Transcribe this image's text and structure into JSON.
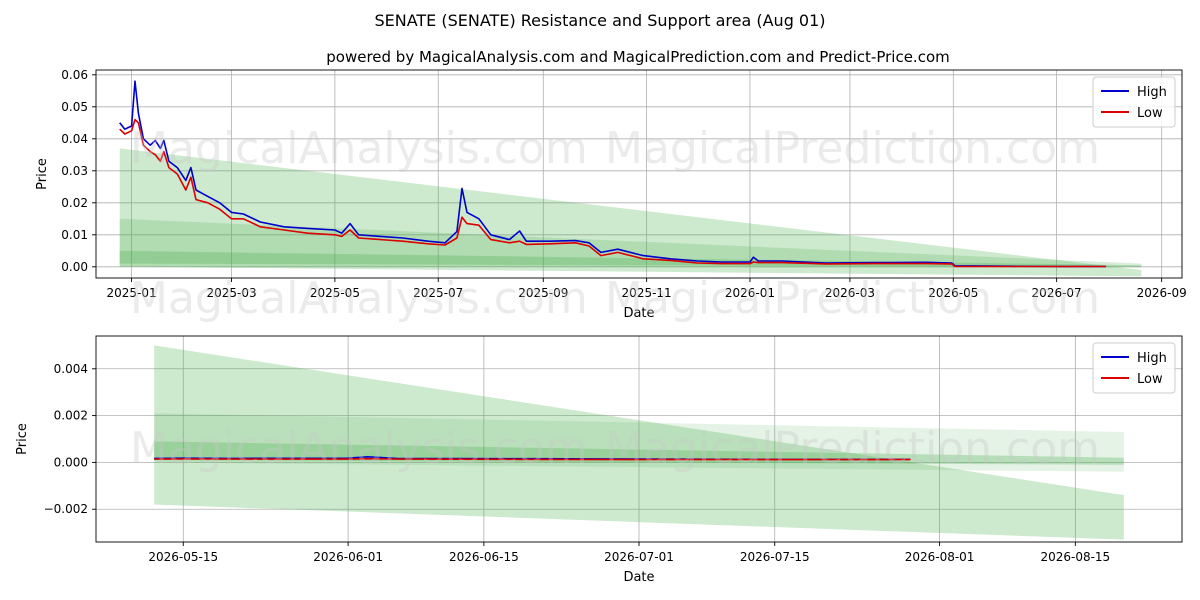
{
  "figure": {
    "title": "SENATE (SENATE) Resistance and Support area (Aug 01)",
    "subtitle": "powered by MagicalAnalysis.com and MagicalPrediction.com and Predict-Price.com",
    "watermarks": [
      "MagicalAnalysis.com",
      "MagicalPrediction.com"
    ]
  },
  "colors": {
    "high": "#0000cc",
    "low": "#dd0000",
    "band": "#4caf50",
    "grid": "#b0b0b0"
  },
  "chart_data": [
    {
      "type": "line",
      "name": "overview",
      "xlabel": "Date",
      "ylabel": "Price",
      "ylim": [
        -0.0035,
        0.0615
      ],
      "xlim": [
        "2024-12-11",
        "2026-09-13"
      ],
      "xticks": [
        "2025-01",
        "2025-03",
        "2025-05",
        "2025-07",
        "2025-09",
        "2025-11",
        "2026-01",
        "2026-03",
        "2026-05",
        "2026-07",
        "2026-09"
      ],
      "xtick_dates": [
        "2025-01-01",
        "2025-03-01",
        "2025-05-01",
        "2025-07-01",
        "2025-09-01",
        "2025-11-01",
        "2026-01-01",
        "2026-03-01",
        "2026-05-01",
        "2026-07-01",
        "2026-09-01"
      ],
      "yticks": [
        "0.00",
        "0.01",
        "0.02",
        "0.03",
        "0.04",
        "0.05",
        "0.06"
      ],
      "ytick_values": [
        0,
        0.01,
        0.02,
        0.03,
        0.04,
        0.05,
        0.06
      ],
      "grid": true,
      "legend": "top-right",
      "legend_entries": [
        "High",
        "Low"
      ],
      "series": [
        {
          "name": "High",
          "color": "#0000cc",
          "points": [
            [
              "2024-12-25",
              0.045
            ],
            [
              "2024-12-28",
              0.043
            ],
            [
              "2025-01-01",
              0.044
            ],
            [
              "2025-01-03",
              0.058
            ],
            [
              "2025-01-05",
              0.048
            ],
            [
              "2025-01-08",
              0.04
            ],
            [
              "2025-01-12",
              0.038
            ],
            [
              "2025-01-15",
              0.0395
            ],
            [
              "2025-01-18",
              0.037
            ],
            [
              "2025-01-20",
              0.0395
            ],
            [
              "2025-01-23",
              0.033
            ],
            [
              "2025-01-28",
              0.031
            ],
            [
              "2025-02-02",
              0.027
            ],
            [
              "2025-02-05",
              0.031
            ],
            [
              "2025-02-08",
              0.024
            ],
            [
              "2025-02-15",
              0.022
            ],
            [
              "2025-02-22",
              0.02
            ],
            [
              "2025-03-01",
              0.017
            ],
            [
              "2025-03-08",
              0.0165
            ],
            [
              "2025-03-18",
              0.014
            ],
            [
              "2025-04-01",
              0.0125
            ],
            [
              "2025-04-15",
              0.012
            ],
            [
              "2025-05-01",
              0.0115
            ],
            [
              "2025-05-05",
              0.0105
            ],
            [
              "2025-05-10",
              0.0135
            ],
            [
              "2025-05-15",
              0.01
            ],
            [
              "2025-05-28",
              0.0095
            ],
            [
              "2025-06-10",
              0.009
            ],
            [
              "2025-06-25",
              0.008
            ],
            [
              "2025-07-05",
              0.0075
            ],
            [
              "2025-07-12",
              0.011
            ],
            [
              "2025-07-15",
              0.0245
            ],
            [
              "2025-07-18",
              0.017
            ],
            [
              "2025-07-25",
              0.015
            ],
            [
              "2025-08-01",
              0.01
            ],
            [
              "2025-08-12",
              0.0085
            ],
            [
              "2025-08-18",
              0.0112
            ],
            [
              "2025-08-22",
              0.008
            ],
            [
              "2025-09-05",
              0.008
            ],
            [
              "2025-09-20",
              0.0082
            ],
            [
              "2025-09-28",
              0.0075
            ],
            [
              "2025-10-05",
              0.0045
            ],
            [
              "2025-10-15",
              0.0055
            ],
            [
              "2025-10-30",
              0.0035
            ],
            [
              "2025-11-15",
              0.0025
            ],
            [
              "2025-12-01",
              0.0018
            ],
            [
              "2025-12-15",
              0.0015
            ],
            [
              "2026-01-01",
              0.0015
            ],
            [
              "2026-01-03",
              0.003
            ],
            [
              "2026-01-06",
              0.0018
            ],
            [
              "2026-01-20",
              0.0018
            ],
            [
              "2026-02-15",
              0.0012
            ],
            [
              "2026-03-15",
              0.0013
            ],
            [
              "2026-04-15",
              0.0014
            ],
            [
              "2026-04-30",
              0.0012
            ],
            [
              "2026-05-02",
              0.0003
            ],
            [
              "2026-06-01",
              0.0002
            ],
            [
              "2026-07-01",
              0.0001
            ],
            [
              "2026-07-30",
              0.0001
            ]
          ]
        },
        {
          "name": "Low",
          "color": "#dd0000",
          "points": [
            [
              "2024-12-25",
              0.043
            ],
            [
              "2024-12-28",
              0.0415
            ],
            [
              "2025-01-01",
              0.0425
            ],
            [
              "2025-01-03",
              0.046
            ],
            [
              "2025-01-05",
              0.045
            ],
            [
              "2025-01-08",
              0.038
            ],
            [
              "2025-01-12",
              0.036
            ],
            [
              "2025-01-15",
              0.035
            ],
            [
              "2025-01-18",
              0.033
            ],
            [
              "2025-01-20",
              0.036
            ],
            [
              "2025-01-23",
              0.031
            ],
            [
              "2025-01-28",
              0.029
            ],
            [
              "2025-02-02",
              0.024
            ],
            [
              "2025-02-05",
              0.028
            ],
            [
              "2025-02-08",
              0.021
            ],
            [
              "2025-02-15",
              0.02
            ],
            [
              "2025-02-22",
              0.018
            ],
            [
              "2025-03-01",
              0.015
            ],
            [
              "2025-03-08",
              0.015
            ],
            [
              "2025-03-18",
              0.0125
            ],
            [
              "2025-04-01",
              0.0115
            ],
            [
              "2025-04-15",
              0.0105
            ],
            [
              "2025-05-01",
              0.01
            ],
            [
              "2025-05-05",
              0.0095
            ],
            [
              "2025-05-10",
              0.0115
            ],
            [
              "2025-05-15",
              0.009
            ],
            [
              "2025-05-28",
              0.0085
            ],
            [
              "2025-06-10",
              0.008
            ],
            [
              "2025-06-25",
              0.0072
            ],
            [
              "2025-07-05",
              0.0068
            ],
            [
              "2025-07-12",
              0.009
            ],
            [
              "2025-07-15",
              0.0155
            ],
            [
              "2025-07-18",
              0.0135
            ],
            [
              "2025-07-25",
              0.013
            ],
            [
              "2025-08-01",
              0.0085
            ],
            [
              "2025-08-12",
              0.0075
            ],
            [
              "2025-08-18",
              0.008
            ],
            [
              "2025-08-22",
              0.007
            ],
            [
              "2025-09-05",
              0.0072
            ],
            [
              "2025-09-20",
              0.0075
            ],
            [
              "2025-09-28",
              0.0065
            ],
            [
              "2025-10-05",
              0.0035
            ],
            [
              "2025-10-15",
              0.0045
            ],
            [
              "2025-10-30",
              0.0025
            ],
            [
              "2025-11-15",
              0.002
            ],
            [
              "2025-12-01",
              0.0012
            ],
            [
              "2025-12-15",
              0.001
            ],
            [
              "2026-01-01",
              0.001
            ],
            [
              "2026-01-03",
              0.0015
            ],
            [
              "2026-01-06",
              0.0013
            ],
            [
              "2026-01-20",
              0.0013
            ],
            [
              "2026-02-15",
              0.0009
            ],
            [
              "2026-03-15",
              0.001
            ],
            [
              "2026-04-15",
              0.001
            ],
            [
              "2026-04-30",
              0.0009
            ],
            [
              "2026-05-02",
              0.0001
            ],
            [
              "2026-06-01",
              0.0001
            ],
            [
              "2026-07-01",
              0.0001
            ],
            [
              "2026-07-30",
              0.0001
            ]
          ]
        }
      ],
      "bands": [
        {
          "x": [
            "2024-12-25",
            "2026-08-20"
          ],
          "upper": [
            0.037,
            -0.001
          ],
          "lower": [
            0.0,
            -0.003
          ],
          "opacity": 0.28
        },
        {
          "x": [
            "2024-12-25",
            "2026-08-20"
          ],
          "upper": [
            0.015,
            0.001
          ],
          "lower": [
            0.0,
            -0.0002
          ],
          "opacity": 0.22
        },
        {
          "x": [
            "2024-12-25",
            "2026-08-20"
          ],
          "upper": [
            0.005,
            0.0005
          ],
          "lower": [
            0.001,
            0.0
          ],
          "opacity": 0.3
        }
      ]
    },
    {
      "type": "line",
      "name": "detail",
      "xlabel": "Date",
      "ylabel": "Price",
      "ylim": [
        -0.0034,
        0.0054
      ],
      "xlim": [
        "2026-05-06",
        "2026-08-26"
      ],
      "xticks": [
        "2026-05-15",
        "2026-06-01",
        "2026-06-15",
        "2026-07-01",
        "2026-07-15",
        "2026-08-01",
        "2026-08-15"
      ],
      "xtick_dates": [
        "2026-05-15",
        "2026-06-01",
        "2026-06-15",
        "2026-07-01",
        "2026-07-15",
        "2026-08-01",
        "2026-08-15"
      ],
      "yticks": [
        "−0.002",
        "0.000",
        "0.002",
        "0.004"
      ],
      "ytick_values": [
        -0.002,
        0,
        0.002,
        0.004
      ],
      "grid": true,
      "legend": "top-right",
      "legend_entries": [
        "High",
        "Low"
      ],
      "series": [
        {
          "name": "High",
          "color": "#0000cc",
          "points": [
            [
              "2026-05-12",
              0.00017
            ],
            [
              "2026-05-15",
              0.00018
            ],
            [
              "2026-05-20",
              0.00017
            ],
            [
              "2026-06-01",
              0.00018
            ],
            [
              "2026-06-03",
              0.00024
            ],
            [
              "2026-06-06",
              0.00017
            ],
            [
              "2026-06-20",
              0.00016
            ],
            [
              "2026-07-01",
              0.00014
            ],
            [
              "2026-07-15",
              0.00013
            ],
            [
              "2026-07-29",
              0.00013
            ]
          ]
        },
        {
          "name": "Low",
          "color": "#dd0000",
          "points": [
            [
              "2026-05-12",
              0.00014
            ],
            [
              "2026-05-15",
              0.00015
            ],
            [
              "2026-05-20",
              0.00014
            ],
            [
              "2026-06-01",
              0.00014
            ],
            [
              "2026-06-03",
              0.00016
            ],
            [
              "2026-06-06",
              0.00014
            ],
            [
              "2026-06-20",
              0.00013
            ],
            [
              "2026-07-01",
              0.00012
            ],
            [
              "2026-07-15",
              0.00012
            ],
            [
              "2026-07-29",
              0.00012
            ]
          ]
        }
      ],
      "bands": [
        {
          "x": [
            "2026-05-12",
            "2026-08-20"
          ],
          "upper": [
            0.005,
            -0.0014
          ],
          "lower": [
            -0.0018,
            -0.0033
          ],
          "opacity": 0.28
        },
        {
          "x": [
            "2026-05-12",
            "2026-08-20"
          ],
          "upper": [
            0.0021,
            0.0013
          ],
          "lower": [
            0.0,
            -0.0004
          ],
          "opacity": 0.15
        },
        {
          "x": [
            "2026-05-12",
            "2026-08-20"
          ],
          "upper": [
            0.0009,
            0.0002
          ],
          "lower": [
            0.0001,
            -0.0001
          ],
          "opacity": 0.3
        }
      ]
    }
  ]
}
